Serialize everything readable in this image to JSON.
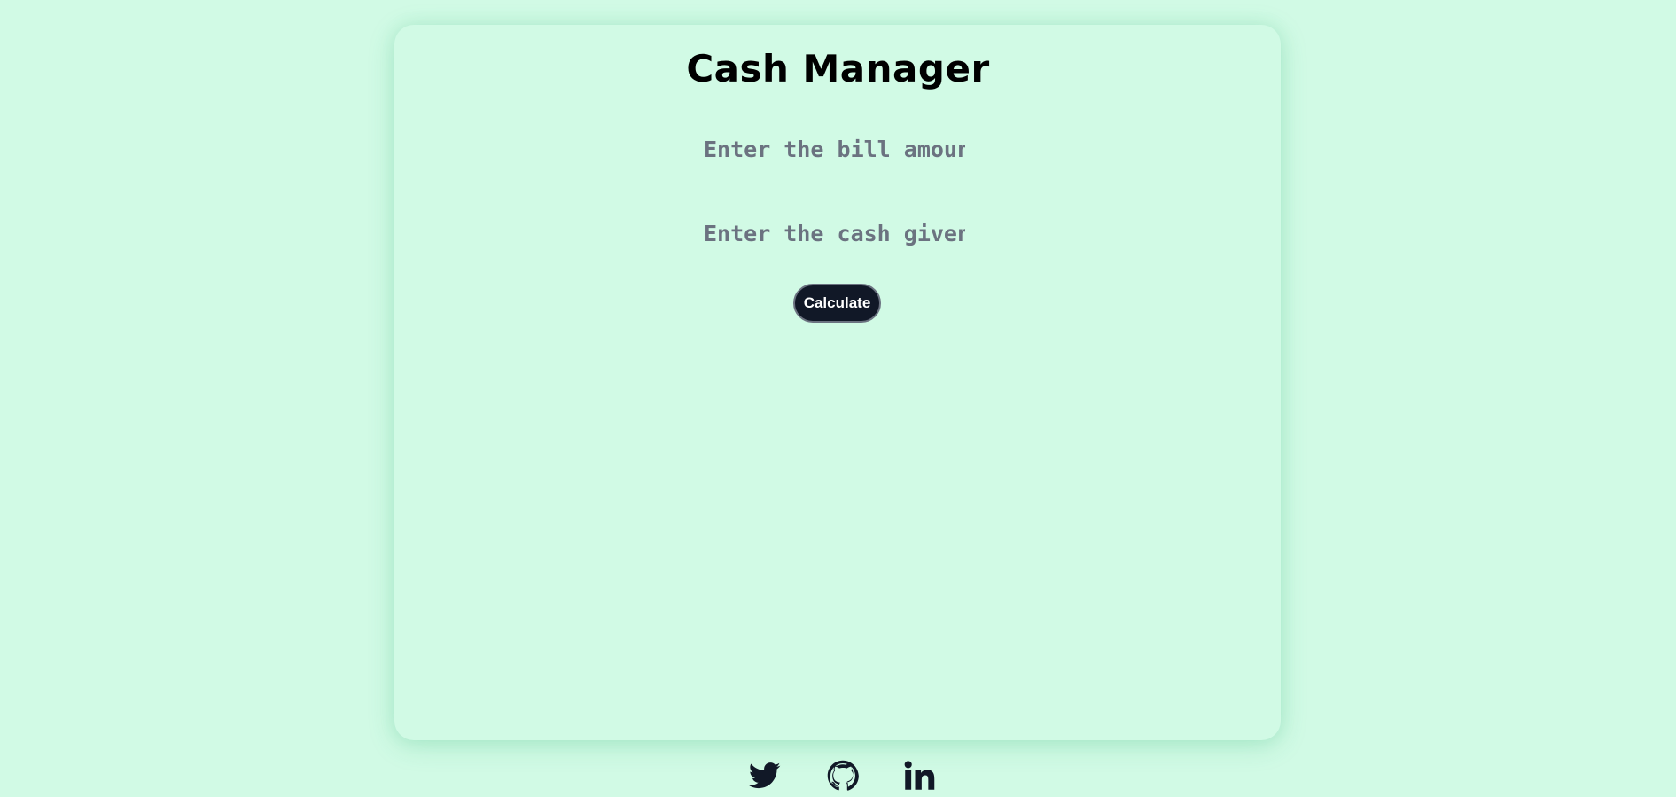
{
  "app": {
    "title": "Cash Manager"
  },
  "form": {
    "bill_placeholder": "Enter the bill amount",
    "cash_placeholder": "Enter the cash given",
    "calculate_label": "Calculate"
  },
  "footer": {
    "links": [
      {
        "icon": "twitter-icon"
      },
      {
        "icon": "github-icon"
      },
      {
        "icon": "linkedin-icon"
      }
    ]
  },
  "colors": {
    "background": "#d1fae5",
    "button": "#111827",
    "icon": "#111827"
  }
}
